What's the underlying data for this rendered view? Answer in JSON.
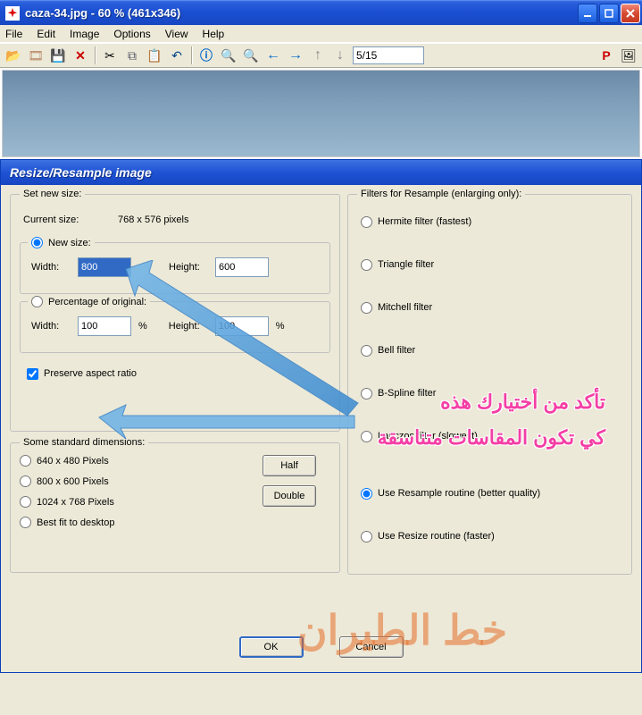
{
  "window": {
    "title": "caza-34.jpg - 60 % (461x346)"
  },
  "menu": {
    "file": "File",
    "edit": "Edit",
    "image": "Image",
    "options": "Options",
    "view": "View",
    "help": "Help"
  },
  "toolbar": {
    "counter": "5/15",
    "p_label": "P"
  },
  "dialog": {
    "title": "Resize/Resample image",
    "set_new_size": "Set new size:",
    "current_size_label": "Current size:",
    "current_size_value": "768  x  576  pixels",
    "new_size_label": "New size:",
    "width_label": "Width:",
    "height_label": "Height:",
    "width_value": "800",
    "height_value": "600",
    "pct_label": "Percentage of original:",
    "pct_width": "100",
    "pct_height": "100",
    "pct_sym": "%",
    "preserve": "Preserve aspect ratio",
    "std_title": "Some standard dimensions:",
    "std1": "640 x 480 Pixels",
    "std2": "800 x 600 Pixels",
    "std3": "1024 x 768 Pixels",
    "std4": "Best fit to desktop",
    "half": "Half",
    "double": "Double",
    "filters_title": "Filters for Resample (enlarging only):",
    "filter1": "Hermite filter (fastest)",
    "filter2": "Triangle filter",
    "filter3": "Mitchell filter",
    "filter4": "Bell filter",
    "filter5": "B-Spline filter",
    "filter6": "Lanczos filter (slowest)",
    "routine1": "Use Resample routine (better quality)",
    "routine2": "Use Resize routine (faster)",
    "ok": "OK",
    "cancel": "Cancel"
  },
  "annotation": {
    "line1": "تأكد من أختيارك هذه",
    "line2": "كي تكون المقاسات متناسقة",
    "watermark": "خط الطيران"
  }
}
